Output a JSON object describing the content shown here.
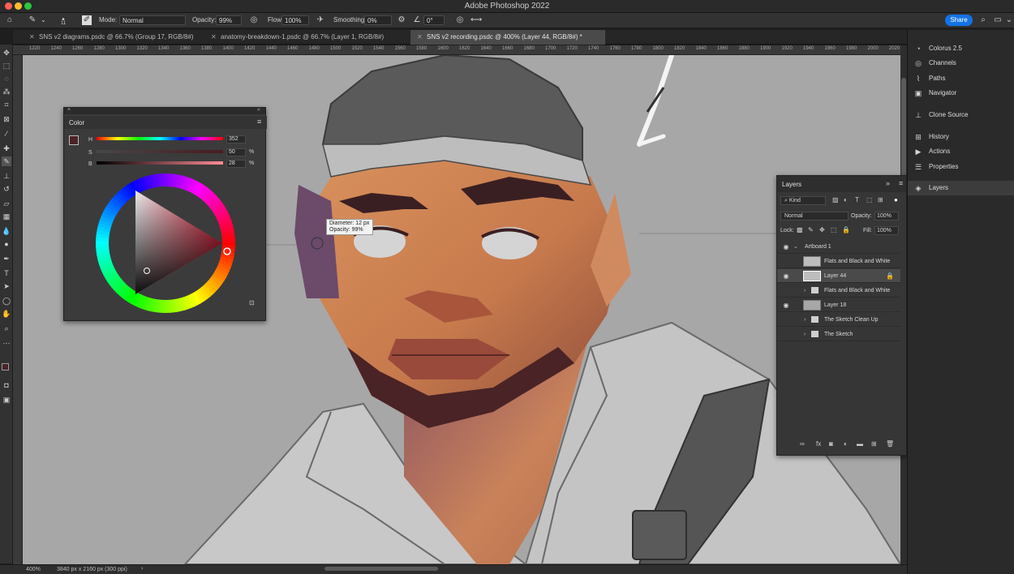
{
  "window": {
    "title": "Adobe Photoshop 2022"
  },
  "options_bar": {
    "brush_size": "11",
    "mode_label": "Mode:",
    "mode_value": "Normal",
    "opacity_label": "Opacity:",
    "opacity_value": "99%",
    "flow_label": "Flow:",
    "flow_value": "100%",
    "smoothing_label": "Smoothing:",
    "smoothing_value": "0%",
    "angle_value": "0°",
    "share_label": "Share"
  },
  "tabs": [
    {
      "label": "SNS v2 diagrams.psdc @ 66.7% (Group 17, RGB/8#)"
    },
    {
      "label": "anatomy-breakdown-1.psdc @ 66.7% (Layer 1, RGB/8#)"
    },
    {
      "label": "SNS v2 recording.psdc @ 400% (Layer 44, RGB/8#) *"
    }
  ],
  "ruler_ticks": [
    "1220",
    "1240",
    "1260",
    "1280",
    "1300",
    "1320",
    "1340",
    "1360",
    "1380",
    "1400",
    "1420",
    "1440",
    "1460",
    "1480",
    "1500",
    "1520",
    "1540",
    "1560",
    "1580",
    "1600",
    "1620",
    "1640",
    "1660",
    "1680",
    "1700",
    "1720",
    "1740",
    "1760",
    "1780",
    "1800",
    "1820",
    "1840",
    "1860",
    "1880",
    "1900",
    "1920",
    "1940",
    "1960",
    "1980",
    "2000",
    "2020"
  ],
  "color_panel": {
    "tab": "Color",
    "h_label": "H",
    "h_value": "352",
    "s_label": "S",
    "s_value": "50",
    "b_label": "B",
    "b_value": "28",
    "unit": "%",
    "foreground_color": "#4a2326",
    "wheel_hue": 352,
    "saturation": 50,
    "brightness": 28
  },
  "brush_tooltip": {
    "diameter": "Diameter: 12 px",
    "opacity": "Opacity: 99%"
  },
  "right_dock": [
    {
      "label": "Colorus 2.5",
      "icon": "colorus-icon"
    },
    {
      "label": "Channels",
      "icon": "channels-icon"
    },
    {
      "label": "Paths",
      "icon": "paths-icon"
    },
    {
      "label": "Navigator",
      "icon": "navigator-icon"
    },
    {
      "label": "Clone Source",
      "icon": "clone-source-icon"
    },
    {
      "label": "History",
      "icon": "history-icon"
    },
    {
      "label": "Actions",
      "icon": "actions-icon"
    },
    {
      "label": "Properties",
      "icon": "properties-icon"
    },
    {
      "label": "Layers",
      "icon": "layers-icon"
    }
  ],
  "layers_panel": {
    "title": "Layers",
    "filter_kind": "Kind",
    "blend_mode": "Normal",
    "opacity_label": "Opacity:",
    "opacity_value": "100%",
    "lock_label": "Lock:",
    "fill_label": "Fill:",
    "fill_value": "100%",
    "layers": [
      {
        "name": "Artboard 1",
        "visible": true,
        "kind": "artboard"
      },
      {
        "name": "Flats and Black and White",
        "visible": false,
        "kind": "layer"
      },
      {
        "name": "Layer 44",
        "visible": true,
        "kind": "layer",
        "selected": true
      },
      {
        "name": "Flats and Black and White",
        "visible": false,
        "kind": "group"
      },
      {
        "name": "Layer 18",
        "visible": true,
        "kind": "layer"
      },
      {
        "name": "The Sketch Clean Up",
        "visible": false,
        "kind": "group"
      },
      {
        "name": "The Sketch",
        "visible": false,
        "kind": "group"
      }
    ]
  },
  "status": {
    "zoom": "400%",
    "doc_size": "3840 px x 2160 px (300 ppi)"
  }
}
